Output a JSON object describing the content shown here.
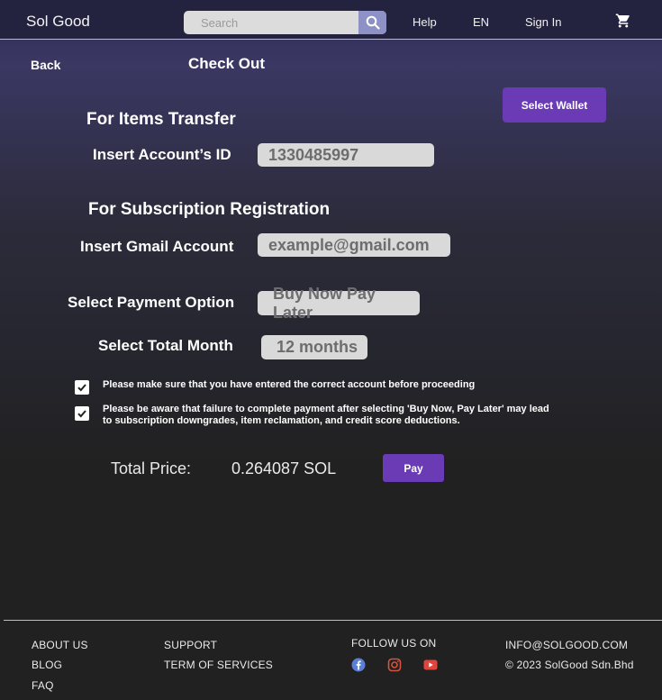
{
  "header": {
    "logo": "Sol Good",
    "search_placeholder": "Search",
    "nav": {
      "help": "Help",
      "language": "EN",
      "sign_in": "Sign In"
    }
  },
  "page": {
    "back": "Back",
    "title": "Check Out",
    "select_wallet": "Select Wallet"
  },
  "items_transfer": {
    "title": "For Items Transfer",
    "account_label": "Insert Account’s ID",
    "account_value": "1330485997"
  },
  "subscription": {
    "title": "For Subscription Registration",
    "gmail_label": "Insert Gmail Account",
    "gmail_value": "example@gmail.com",
    "payment_label": "Select Payment Option",
    "payment_value": "Buy Now Pay Later",
    "month_label": "Select Total Month",
    "month_value": "12 months"
  },
  "confirmations": [
    {
      "checked": true,
      "text": "Please make sure that you have entered the correct account before proceeding"
    },
    {
      "checked": true,
      "text": "Please be aware that failure to complete payment after selecting 'Buy Now, Pay Later' may lead to subscription downgrades, item reclamation, and credit score deductions."
    }
  ],
  "total": {
    "label": "Total Price:",
    "value": "0.264087 SOL",
    "pay": "Pay"
  },
  "footer": {
    "col1": [
      "ABOUT US",
      "BLOG",
      "FAQ"
    ],
    "col2": [
      "SUPPORT",
      "TERM OF SERVICES"
    ],
    "follow": "FOLLOW US ON",
    "email": "INFO@SOLGOOD.COM",
    "copyright": "© 2023 SolGood Sdn.Bhd",
    "social_icons": [
      "facebook-icon",
      "instagram-icon",
      "youtube-icon"
    ]
  },
  "colors": {
    "accent": "#6a3bb5",
    "header_bg": "#232340",
    "search_button": "#8e91c6",
    "facebook": "#5b7fd6",
    "instagram": "#d8533f",
    "youtube": "#e0443a"
  }
}
